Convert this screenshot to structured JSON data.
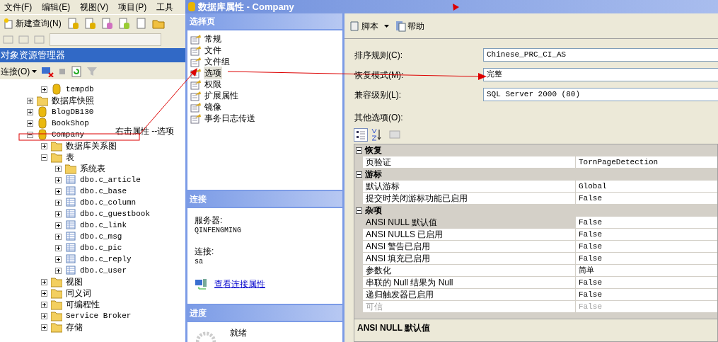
{
  "menu_bar": [
    "文件(F)",
    "编辑(E)",
    "视图(V)",
    "项目(P)",
    "工具"
  ],
  "toolbar": {
    "new_query": "新建查询(N)"
  },
  "object_explorer": {
    "title": "对象资源管理器",
    "connect": "连接(O)",
    "tree": [
      {
        "kind": "hidden_parent",
        "children": [
          {
            "label": "tempdb",
            "kind": "database",
            "expanded": false
          }
        ]
      },
      {
        "label": "数据库快照",
        "kind": "folder",
        "expanded": false
      },
      {
        "label": "BlogDB130",
        "kind": "database",
        "expanded": false
      },
      {
        "label": "BookShop",
        "kind": "database",
        "expanded": false
      },
      {
        "label": "Company",
        "kind": "database",
        "expanded": true,
        "children": [
          {
            "label": "数据库关系图",
            "kind": "folder",
            "expanded": false
          },
          {
            "label": "表",
            "kind": "folder",
            "expanded": true,
            "children": [
              {
                "label": "系统表",
                "kind": "folder",
                "expanded": false
              },
              {
                "label": "dbo.c_article",
                "kind": "table",
                "expanded": false
              },
              {
                "label": "dbo.c_base",
                "kind": "table",
                "expanded": false
              },
              {
                "label": "dbo.c_column",
                "kind": "table",
                "expanded": false
              },
              {
                "label": "dbo.c_guestbook",
                "kind": "table",
                "expanded": false
              },
              {
                "label": "dbo.c_link",
                "kind": "table",
                "expanded": false
              },
              {
                "label": "dbo.c_msg",
                "kind": "table",
                "expanded": false
              },
              {
                "label": "dbo.c_pic",
                "kind": "table",
                "expanded": false
              },
              {
                "label": "dbo.c_reply",
                "kind": "table",
                "expanded": false
              },
              {
                "label": "dbo.c_user",
                "kind": "table",
                "expanded": false
              }
            ]
          },
          {
            "label": "视图",
            "kind": "folder",
            "expanded": false
          },
          {
            "label": "同义词",
            "kind": "folder",
            "expanded": false
          },
          {
            "label": "可编程性",
            "kind": "folder",
            "expanded": false
          },
          {
            "label": "Service Broker",
            "kind": "folder",
            "expanded": false
          },
          {
            "label": "存储",
            "kind": "folder",
            "expanded": false
          }
        ]
      }
    ]
  },
  "annotation": "右击属性 --选项",
  "dialog": {
    "title": "数据库属性 - Company",
    "select_page": {
      "header": "选择页",
      "items": [
        {
          "label": "常规",
          "selected": false
        },
        {
          "label": "文件",
          "selected": false
        },
        {
          "label": "文件组",
          "selected": false
        },
        {
          "label": "选项",
          "selected": true
        },
        {
          "label": "权限",
          "selected": false
        },
        {
          "label": "扩展属性",
          "selected": false
        },
        {
          "label": "镜像",
          "selected": false
        },
        {
          "label": "事务日志传送",
          "selected": false
        }
      ]
    },
    "connection": {
      "header": "连接",
      "server_label": "服务器:",
      "server": "QINFENGMING",
      "login_label": "连接:",
      "login": "sa",
      "link": "查看连接属性"
    },
    "progress": {
      "header": "进度",
      "status": "就绪"
    },
    "toolbar": {
      "script": "脚本",
      "help": "帮助"
    },
    "fields": [
      {
        "label": "排序规则(C):",
        "value": "Chinese_PRC_CI_AS"
      },
      {
        "label": "恢复模式(M):",
        "value": "完整"
      },
      {
        "label": "兼容级别(L):",
        "value": "SQL Server 2000 (80)"
      }
    ],
    "other_options": "其他选项(O):",
    "property_grid": [
      {
        "category": "恢复",
        "expanded": true,
        "rows": [
          {
            "name": "页验证",
            "value": "TornPageDetection",
            "selected": false,
            "disabled": false
          }
        ]
      },
      {
        "category": "游标",
        "expanded": true,
        "rows": [
          {
            "name": "默认游标",
            "value": "Global",
            "selected": false,
            "disabled": false
          },
          {
            "name": "提交时关闭游标功能已启用",
            "value": "False",
            "selected": false,
            "disabled": false
          }
        ]
      },
      {
        "category": "杂项",
        "expanded": true,
        "rows": [
          {
            "name": "ANSI NULL 默认值",
            "value": "False",
            "selected": true,
            "disabled": false
          },
          {
            "name": "ANSI NULLS 已启用",
            "value": "False",
            "selected": false,
            "disabled": false
          },
          {
            "name": "ANSI 警告已启用",
            "value": "False",
            "selected": false,
            "disabled": false
          },
          {
            "name": "ANSI 填充已启用",
            "value": "False",
            "selected": false,
            "disabled": false
          },
          {
            "name": "参数化",
            "value": "简单",
            "selected": false,
            "disabled": false
          },
          {
            "name": "串联的 Null 结果为 Null",
            "value": "False",
            "selected": false,
            "disabled": false
          },
          {
            "name": "递归触发器已启用",
            "value": "False",
            "selected": false,
            "disabled": false
          },
          {
            "name": "可信",
            "value": "False",
            "selected": false,
            "disabled": true
          }
        ]
      }
    ],
    "description": "ANSI NULL 默认值"
  }
}
